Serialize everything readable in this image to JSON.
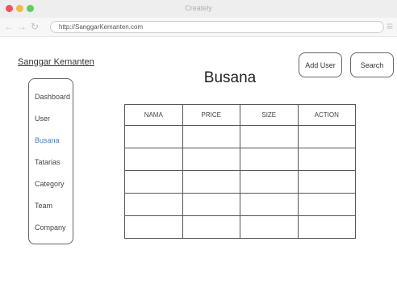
{
  "window": {
    "title": "Creately"
  },
  "browser": {
    "url": "http://SanggarKemanten.com"
  },
  "brand": "Sanggar Kemanten",
  "page": {
    "title": "Busana"
  },
  "toolbar": {
    "add_user_label": "Add User",
    "search_label": "Search"
  },
  "sidebar": {
    "items": [
      {
        "label": "Dashboard"
      },
      {
        "label": "User"
      },
      {
        "label": "Busana",
        "active": true
      },
      {
        "label": "Tatarias"
      },
      {
        "label": "Category"
      },
      {
        "label": "Team"
      },
      {
        "label": "Company"
      }
    ]
  },
  "table": {
    "columns": [
      "NAMA",
      "PRICE",
      "SIZE",
      "ACTION"
    ],
    "rows": [
      [
        "",
        "",
        "",
        ""
      ],
      [
        "",
        "",
        "",
        ""
      ],
      [
        "",
        "",
        "",
        ""
      ],
      [
        "",
        "",
        "",
        ""
      ],
      [
        "",
        "",
        "",
        ""
      ]
    ]
  },
  "colors": {
    "active_link": "#4a7bd0",
    "close": "#f0525f",
    "minimize": "#f6bb3a",
    "maximize": "#5ccf5b"
  }
}
